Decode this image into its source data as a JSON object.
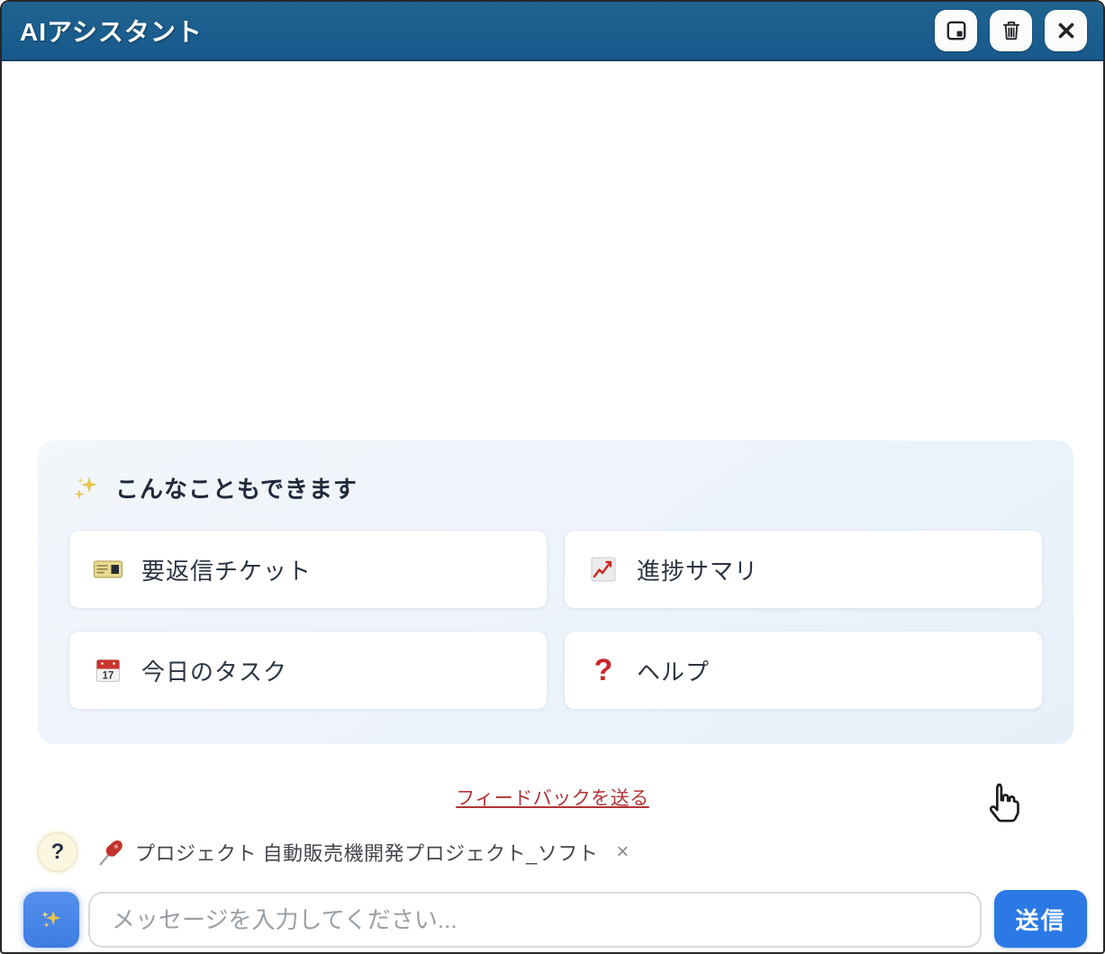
{
  "header": {
    "title": "AIアシスタント",
    "buttons": [
      {
        "name": "popout",
        "icon": "popout-icon"
      },
      {
        "name": "clear",
        "icon": "trash-icon"
      },
      {
        "name": "close",
        "icon": "close-icon"
      }
    ]
  },
  "suggestions": {
    "title_icon": "sparkles-icon",
    "title": "こんなこともできます",
    "calendar_day": "17",
    "question_glyph": "?",
    "items": [
      {
        "label": "要返信チケット",
        "icon": "ticket-icon"
      },
      {
        "label": "進捗サマリ",
        "icon": "chart-increasing-icon"
      },
      {
        "label": "今日のタスク",
        "icon": "calendar-icon"
      },
      {
        "label": "ヘルプ",
        "icon": "red-question-mark-icon"
      }
    ]
  },
  "feedback_link": "フィードバックを送る",
  "context_bar": {
    "help_label": "?",
    "pin_icon": "pushpin-icon",
    "text": "プロジェクト 自動販売機開発プロジェクト_ソフト",
    "remove_label": "×"
  },
  "composer": {
    "sparkle_icon": "sparkles-icon",
    "placeholder": "メッセージを入力してください...",
    "send_label": "送信"
  },
  "colors": {
    "titlebar_blue": "#175a8c",
    "accent_blue": "#2b79e4",
    "link_red": "#b23434",
    "card_bg": "#edf3fa",
    "question_red": "#c9262b"
  }
}
